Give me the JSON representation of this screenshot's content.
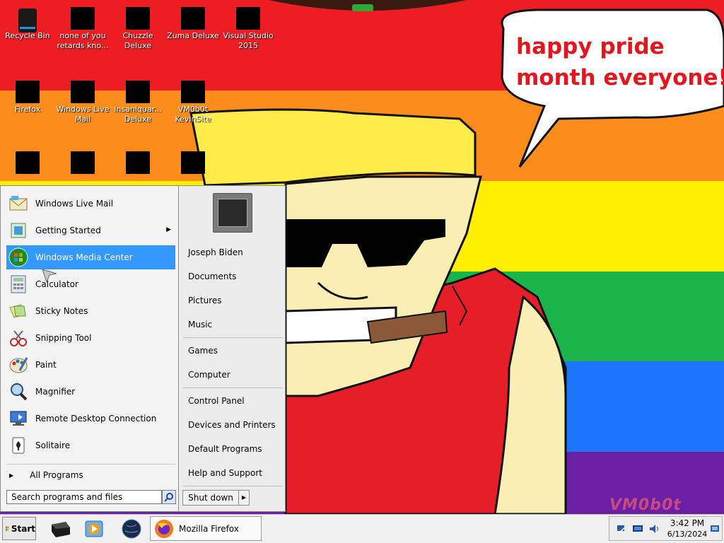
{
  "desktop": {
    "icons": [
      {
        "label": "Recycle Bin",
        "name": "recycle-bin"
      },
      {
        "label": "none of you retards kno...",
        "name": "none-of-you-shortcut"
      },
      {
        "label": "Chuzzle Deluxe",
        "name": "chuzzle-deluxe"
      },
      {
        "label": "Zuma Deluxe",
        "name": "zuma-deluxe"
      },
      {
        "label": "Visual Studio 2015",
        "name": "visual-studio-2015"
      },
      {
        "label": "Firefox",
        "name": "firefox"
      },
      {
        "label": "Windows Live Mail",
        "name": "windows-live-mail"
      },
      {
        "label": "Insaniquar... Deluxe",
        "name": "insaniquarium-deluxe"
      },
      {
        "label": "VM0b0t KevinSite",
        "name": "vm0b0t-kevinsite"
      }
    ],
    "bubble_text": "happy pride month everyone!",
    "signature": "VM0b0t"
  },
  "start_menu": {
    "programs": [
      {
        "label": "Windows Live Mail",
        "icon": "mail-icon",
        "submenu": false
      },
      {
        "label": "Getting Started",
        "icon": "getting-started-icon",
        "submenu": true
      },
      {
        "label": "Windows Media Center",
        "icon": "media-center-icon",
        "submenu": false,
        "highlighted": true
      },
      {
        "label": "Calculator",
        "icon": "calculator-icon",
        "submenu": false
      },
      {
        "label": "Sticky Notes",
        "icon": "sticky-notes-icon",
        "submenu": false
      },
      {
        "label": "Snipping Tool",
        "icon": "snipping-tool-icon",
        "submenu": false
      },
      {
        "label": "Paint",
        "icon": "paint-icon",
        "submenu": false
      },
      {
        "label": "Magnifier",
        "icon": "magnifier-icon",
        "submenu": false
      },
      {
        "label": "Remote Desktop Connection",
        "icon": "remote-desktop-icon",
        "submenu": false
      },
      {
        "label": "Solitaire",
        "icon": "solitaire-icon",
        "submenu": false
      }
    ],
    "all_programs": "All Programs",
    "search_placeholder": "Search programs and files",
    "right_items": {
      "user": "Joseph Biden",
      "documents": "Documents",
      "pictures": "Pictures",
      "music": "Music",
      "games": "Games",
      "computer": "Computer",
      "control_panel": "Control Panel",
      "devices_printers": "Devices and Printers",
      "default_programs": "Default Programs",
      "help_support": "Help and Support"
    },
    "shutdown_label": "Shut down"
  },
  "taskbar": {
    "start_label": "Start",
    "task_label": "Mozilla Firefox",
    "clock_time": "3:42 PM",
    "clock_date": "6/13/2024"
  },
  "colors": {
    "rainbow": [
      "#ee1d23",
      "#fc8c1c",
      "#ffee00",
      "#1ab54a",
      "#1a74ff",
      "#6b1fa4"
    ],
    "highlight": "#3399ff",
    "bubble_text": "#e4151c"
  }
}
